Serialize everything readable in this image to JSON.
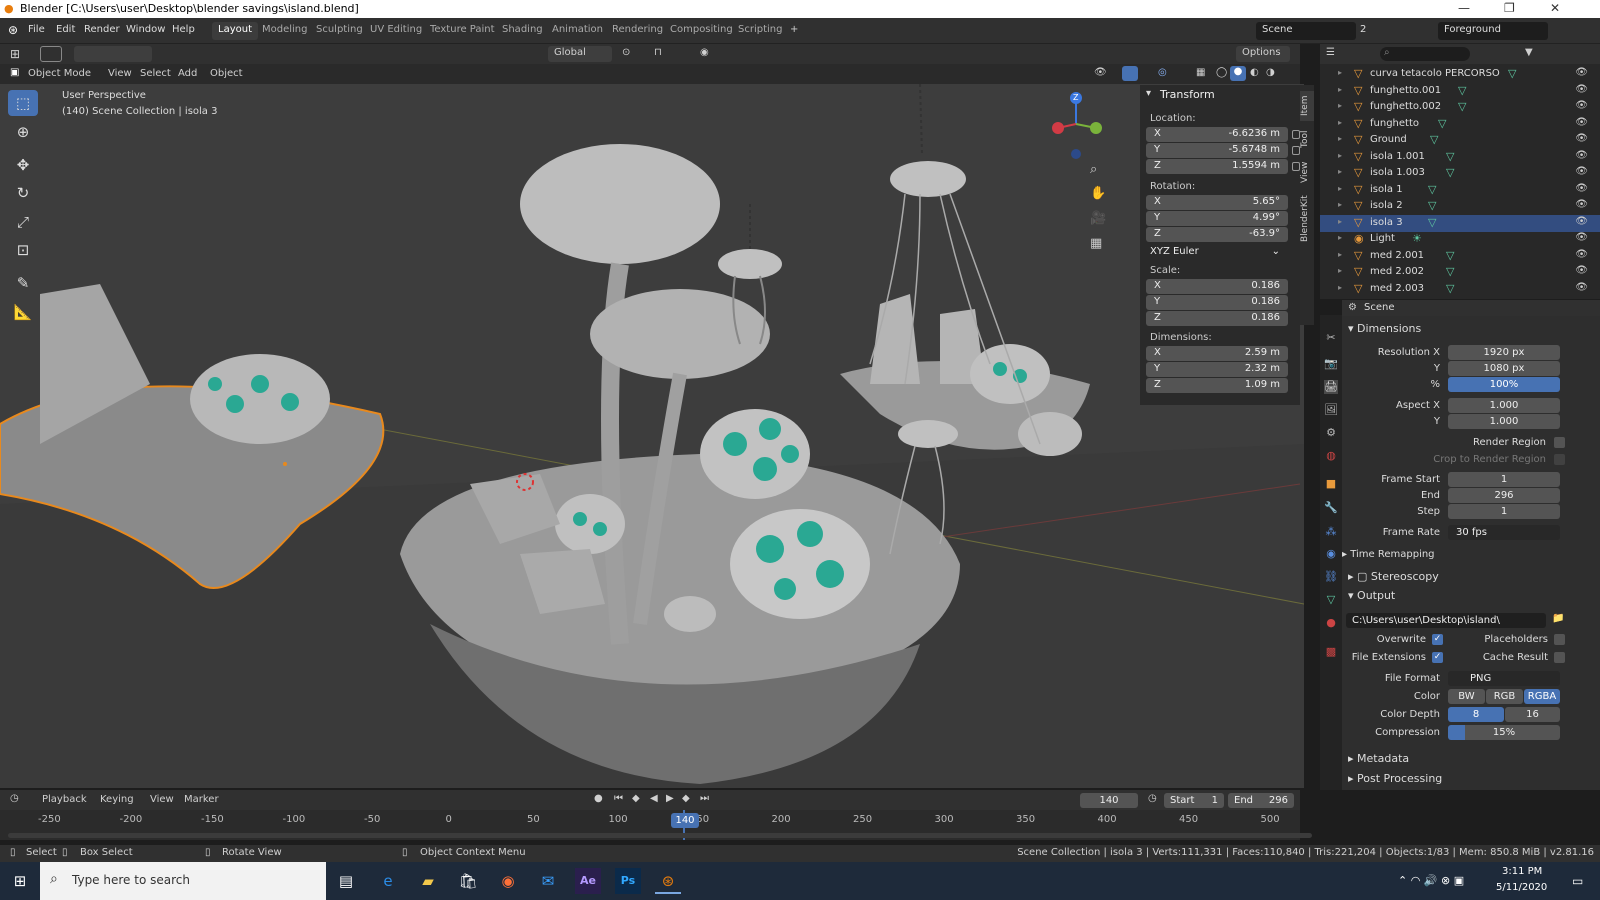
{
  "window": {
    "title": "Blender [C:\\Users\\user\\Desktop\\blender savings\\island.blend]",
    "minimize": "—",
    "maximize": "❐",
    "close": "✕"
  },
  "menu": {
    "items": [
      "File",
      "Edit",
      "Render",
      "Window",
      "Help"
    ],
    "workspaces": [
      "Layout",
      "Modeling",
      "Sculpting",
      "UV Editing",
      "Texture Paint",
      "Shading",
      "Animation",
      "Rendering",
      "Compositing",
      "Scripting"
    ],
    "add_workspace": "+",
    "scene": "Scene",
    "scene_count": "2",
    "view_layer": "Foreground"
  },
  "viewport_header": {
    "transform_orientation": "Global",
    "options": "Options",
    "mode": "Object Mode",
    "view": "View",
    "select": "Select",
    "add": "Add",
    "object": "Object"
  },
  "viewport": {
    "perspective": "User Perspective",
    "collection_info": "(140) Scene Collection | isola 3",
    "gizmo_z": "Z"
  },
  "npanel": {
    "title": "Transform",
    "location_label": "Location:",
    "location": [
      {
        "k": "X",
        "v": "-6.6236 m"
      },
      {
        "k": "Y",
        "v": "-5.6748 m"
      },
      {
        "k": "Z",
        "v": "1.5594 m"
      }
    ],
    "rotation_label": "Rotation:",
    "rotation": [
      {
        "k": "X",
        "v": "5.65°"
      },
      {
        "k": "Y",
        "v": "4.99°"
      },
      {
        "k": "Z",
        "v": "-63.9°"
      }
    ],
    "rotation_mode": "XYZ Euler",
    "scale_label": "Scale:",
    "scale": [
      {
        "k": "X",
        "v": "0.186"
      },
      {
        "k": "Y",
        "v": "0.186"
      },
      {
        "k": "Z",
        "v": "0.186"
      }
    ],
    "dimensions_label": "Dimensions:",
    "dimensions": [
      {
        "k": "X",
        "v": "2.59 m"
      },
      {
        "k": "Y",
        "v": "2.32 m"
      },
      {
        "k": "Z",
        "v": "1.09 m"
      }
    ],
    "tabs": [
      "Item",
      "Tool",
      "View",
      "BlenderKit"
    ]
  },
  "outliner": {
    "items": [
      "curva tetacolo PERCORSO",
      "funghetto.001",
      "funghetto.002",
      "funghetto",
      "Ground",
      "isola 1.001",
      "isola 1.003",
      "isola 1",
      "isola 2",
      "isola 3",
      "Light",
      "med 2.001",
      "med 2.002",
      "med 2.003"
    ],
    "selected": "isola 3"
  },
  "properties": {
    "context": "Scene",
    "dimensions": "Dimensions",
    "resolution_x_label": "Resolution X",
    "resolution_x": "1920 px",
    "resolution_y_label": "Y",
    "resolution_y": "1080 px",
    "percent_label": "%",
    "percent": "100%",
    "aspect_x_label": "Aspect X",
    "aspect_x": "1.000",
    "aspect_y_label": "Y",
    "aspect_y": "1.000",
    "render_region": "Render Region",
    "crop": "Crop to Render Region",
    "frame_start_label": "Frame Start",
    "frame_start": "1",
    "end_label": "End",
    "end": "296",
    "step_label": "Step",
    "step": "1",
    "frame_rate_label": "Frame Rate",
    "frame_rate": "30 fps",
    "time_remapping": "Time Remapping",
    "stereoscopy": "Stereoscopy",
    "output": "Output",
    "output_path": "C:\\Users\\user\\Desktop\\island\\",
    "overwrite": "Overwrite",
    "placeholders": "Placeholders",
    "file_extensions": "File Extensions",
    "cache_result": "Cache Result",
    "file_format_label": "File Format",
    "file_format": "PNG",
    "color_label": "Color",
    "color_bw": "BW",
    "color_rgb": "RGB",
    "color_rgba": "RGBA",
    "color_depth_label": "Color Depth",
    "depth_8": "8",
    "depth_16": "16",
    "compression_label": "Compression",
    "compression": "15%",
    "metadata": "Metadata",
    "post_processing": "Post Processing"
  },
  "timeline": {
    "playback": "Playback",
    "keying": "Keying",
    "view": "View",
    "marker": "Marker",
    "current": "140",
    "start_label": "Start",
    "start": "1",
    "end_label": "End",
    "end": "296",
    "ticks": [
      "-250",
      "-200",
      "-150",
      "-100",
      "-50",
      "0",
      "50",
      "100",
      "150",
      "200",
      "250",
      "300",
      "350",
      "400",
      "450",
      "500"
    ]
  },
  "status": {
    "select": "Select",
    "box_select": "Box Select",
    "rotate_view": "Rotate View",
    "context_menu": "Object Context Menu",
    "info": "Scene Collection | isola 3 | Verts:111,331 | Faces:110,840 | Tris:221,204 | Objects:1/83 | Mem: 850.8 MiB | v2.81.16"
  },
  "taskbar": {
    "search": "Type here to search",
    "time": "3:11 PM",
    "date": "5/11/2020"
  }
}
